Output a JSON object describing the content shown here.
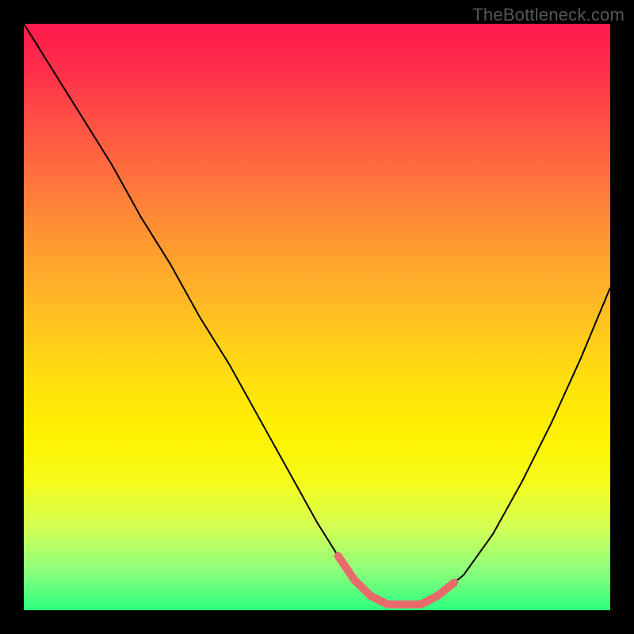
{
  "watermark": "TheBottleneck.com",
  "colors": {
    "background": "#000000",
    "curve": "#000000",
    "valley_highlight": "#e96a6a"
  },
  "chart_data": {
    "type": "line",
    "title": "",
    "xlabel": "",
    "ylabel": "",
    "xlim": [
      0,
      100
    ],
    "ylim": [
      0,
      100
    ],
    "grid": false,
    "x": [
      0,
      5,
      10,
      15,
      20,
      25,
      30,
      35,
      40,
      45,
      50,
      55,
      58,
      60,
      62,
      65,
      68,
      70,
      75,
      80,
      85,
      90,
      95,
      100
    ],
    "values": [
      100,
      92,
      84,
      76,
      67,
      59,
      50,
      42,
      33,
      24,
      15,
      7,
      3,
      2,
      1,
      1,
      1,
      2,
      6,
      13,
      22,
      32,
      43,
      55
    ],
    "valley_range_x": [
      55,
      72
    ],
    "annotations": []
  }
}
